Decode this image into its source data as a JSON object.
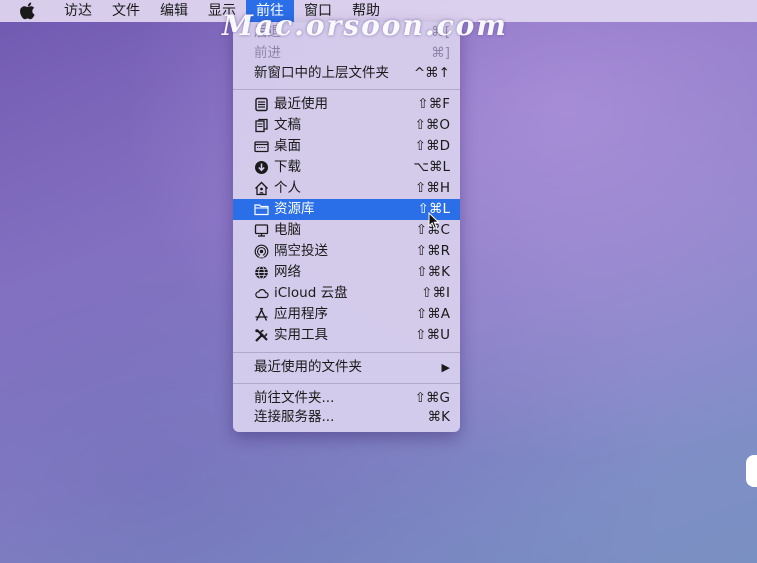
{
  "menubar": {
    "items": [
      {
        "label": "访达"
      },
      {
        "label": "文件"
      },
      {
        "label": "编辑"
      },
      {
        "label": "显示"
      },
      {
        "label": "前往"
      },
      {
        "label": "窗口"
      },
      {
        "label": "帮助"
      }
    ]
  },
  "watermark": {
    "text": "Mac.orsoon.com"
  },
  "go_menu": {
    "items": [
      {
        "label": "后退",
        "shortcut": "⌘["
      },
      {
        "label": "前进",
        "shortcut": "⌘]"
      },
      {
        "label": "新窗口中的上层文件夹",
        "shortcut": "^⌘↑"
      },
      {
        "label": "最近使用",
        "shortcut": "⇧⌘F",
        "icon": "recents-icon"
      },
      {
        "label": "文稿",
        "shortcut": "⇧⌘O",
        "icon": "documents-icon"
      },
      {
        "label": "桌面",
        "shortcut": "⇧⌘D",
        "icon": "desktop-icon"
      },
      {
        "label": "下载",
        "shortcut": "⌥⌘L",
        "icon": "downloads-icon"
      },
      {
        "label": "个人",
        "shortcut": "⇧⌘H",
        "icon": "home-icon"
      },
      {
        "label": "资源库",
        "shortcut": "⇧⌘L",
        "icon": "folder-icon"
      },
      {
        "label": "电脑",
        "shortcut": "⇧⌘C",
        "icon": "computer-icon"
      },
      {
        "label": "隔空投送",
        "shortcut": "⇧⌘R",
        "icon": "airdrop-icon"
      },
      {
        "label": "网络",
        "shortcut": "⇧⌘K",
        "icon": "network-icon"
      },
      {
        "label": "iCloud 云盘",
        "shortcut": "⇧⌘I",
        "icon": "icloud-icon"
      },
      {
        "label": "应用程序",
        "shortcut": "⇧⌘A",
        "icon": "applications-icon"
      },
      {
        "label": "实用工具",
        "shortcut": "⇧⌘U",
        "icon": "utilities-icon"
      },
      {
        "label": "最近使用的文件夹",
        "shortcut": "▶"
      },
      {
        "label": "前往文件夹...",
        "shortcut": "⇧⌘G"
      },
      {
        "label": "连接服务器...",
        "shortcut": "⌘K"
      }
    ]
  }
}
